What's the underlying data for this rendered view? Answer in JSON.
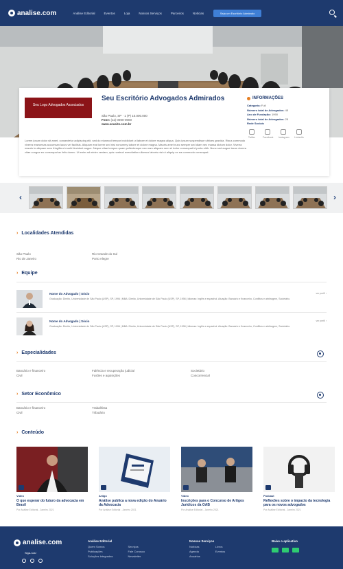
{
  "nav": {
    "logo": "analise.com",
    "menu": [
      "Análise Editorial",
      "Eventos",
      "Loja",
      "Nossos Serviços",
      "Parceiros",
      "Notícias"
    ],
    "cta": "Seja um Escritório Admirado"
  },
  "profile": {
    "logo_text": "Seu Logo Advogados Associados",
    "title": "Seu Escritório Advogados Admirados",
    "address": "São Paulo, SP · 1 (P) 10.000.000",
    "phone_label": "Fone:",
    "phone": "(11) 0000-0000",
    "site": "www.seusite.com.br",
    "description": "Lorem ipsum dolor sit amet, consectetur adipiscing elit, sed do eiusmod tempor incididunt ut labore et dolore magna aliqua. Quis ipsum suspendisse ultrices gravida. Risus commodo viverra maecenas accumsan lacus vel facilisis. Aliquam erat lorem sed nisi nonummy labore et dolore magna. Mauris amet nunc semper sed diam nec massa dictum dolor. Viverra mauris in aliquam sem fringilla ut morbi tincidunt augue. Neque vitae tempus quam pellentesque nec nam aliquam sem et tortor consequat id porta nibh. Nunc sed augue lacus viverra vitae congue eu consequat ac felis donec. Ut enim ad minim veniam, quis nostrud exercitation ullamco laboris nisi ut aliquip ex ea commodo consequat."
  },
  "info": {
    "title": "INFORMAÇÕES",
    "rows": [
      {
        "label": "Categoria:",
        "value": "Full"
      },
      {
        "label": "Número total de Advogados:",
        "value": "45"
      },
      {
        "label": "Ano de Fundação:",
        "value": "1990"
      },
      {
        "label": "Número total de Advogados:",
        "value": "25"
      },
      {
        "label": "Rede Sociais",
        "value": ""
      }
    ],
    "socials": [
      "Twitter",
      "Facebook",
      "Instagram",
      "LinkedIn"
    ]
  },
  "gallery": {
    "prev": "‹",
    "next": "›",
    "count": 8
  },
  "sections": {
    "localidades": {
      "title": "Localidades Atendidas",
      "items": [
        "São Paulo",
        "Rio de Janeiro",
        "Rio Grande do Sul",
        "Porto Alegre"
      ]
    },
    "equipe": {
      "title": "Equipe",
      "members": [
        {
          "name": "Nome do Advogado | Sócio",
          "desc": "Graduação: Direito, Universidade de São Paulo (USP), SP, 1996 | MBA: Direito, Universidade de São Paulo (USP), SP, 1998 | Idiomas: Inglês e espanhol. Atuação: Bancário e financeiro, Conflitos e arbitragem, Societário.",
          "right": "ver perfil ›"
        },
        {
          "name": "Nome do Advogado | Sócio",
          "desc": "Graduação: Direito, Universidade de São Paulo (USP), SP, 1996 | MBA: Direito, Universidade de São Paulo (USP), SP, 1998 | Idiomas: Inglês e espanhol. Atuação: Bancário e financeiro, Conflitos e arbitragem, Societário.",
          "right": "ver perfil ›"
        }
      ]
    },
    "especialidades": {
      "title": "Especialidades",
      "items": [
        "Bancário e financeiro",
        "Civil",
        "Falência e recuperação judicial",
        "Fusões e aquisições",
        "Societário",
        "Concorrencial"
      ]
    },
    "setores": {
      "title": "Setor Econômico",
      "items": [
        "Bancário e financeiro",
        "Civil",
        "Trabalhista",
        "Tributário"
      ]
    },
    "conteudo": {
      "title": "Conteúdo",
      "cards": [
        {
          "cat": "Vídeo",
          "title": "O que esperar do futuro da advocacia em Brasil",
          "date": "Por Análise Editorial - Janeiro 2021"
        },
        {
          "cat": "Artigo",
          "title": "Análise publica a nova edição do Anuário da Advocacia",
          "date": "Por Análise Editorial - Janeiro 2021"
        },
        {
          "cat": "Vídeo",
          "title": "Inscrições para o Concurso de Artigos Jurídicos da OAB",
          "date": "Por Análise Editorial - Janeiro 2021"
        },
        {
          "cat": "Podcast",
          "title": "Reflexões sobre o impacto da tecnologia para os novos advogados",
          "date": "Por Análise Editorial - Janeiro 2021"
        }
      ]
    }
  },
  "footer": {
    "logo": "analise.com",
    "follow": "Siga-nos!",
    "cols": [
      {
        "title": "Análise Editorial",
        "items": [
          "Quem Somos",
          "Publicações",
          "Soluções Integradas",
          "Serviços",
          "Fale Conosco",
          "Newsletter"
        ]
      },
      {
        "title": "Nossos Serviços",
        "items": [
          "Notícias",
          "Agenda",
          "Anuários",
          "Livros",
          "Eventos"
        ]
      }
    ],
    "app_title": "Baixe o aplicativo"
  }
}
